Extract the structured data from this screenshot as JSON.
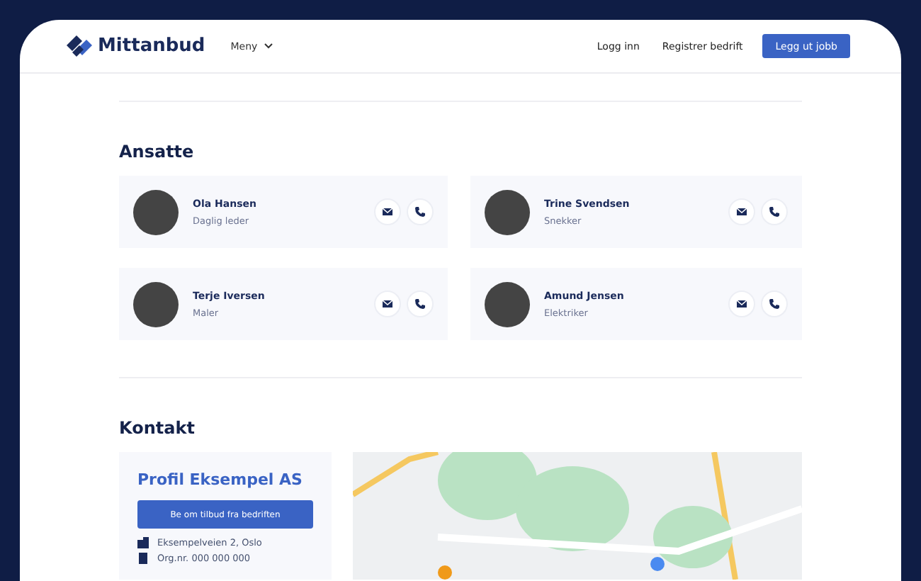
{
  "header": {
    "brand": "Mittanbud",
    "menu": "Meny",
    "links": [
      "Logg inn",
      "Registrer bedrift"
    ],
    "cta": "Legg ut jobb"
  },
  "employees_section": {
    "title": "Ansatte",
    "employees": [
      {
        "name": "Ola Hansen",
        "role": "Daglig leder"
      },
      {
        "name": "Trine Svendsen",
        "role": "Snekker"
      },
      {
        "name": "Terje Iversen",
        "role": "Maler"
      },
      {
        "name": "Amund Jensen",
        "role": "Elektriker"
      }
    ]
  },
  "contact_section": {
    "title": "Kontakt",
    "company": "Profil Eksempel AS",
    "button": "Be om tilbud fra bedriften",
    "details": [
      {
        "kind": "address",
        "text": "Eksempelveien 2, Oslo"
      },
      {
        "kind": "org",
        "text": "Org.nr. 000 000 000"
      }
    ]
  }
}
